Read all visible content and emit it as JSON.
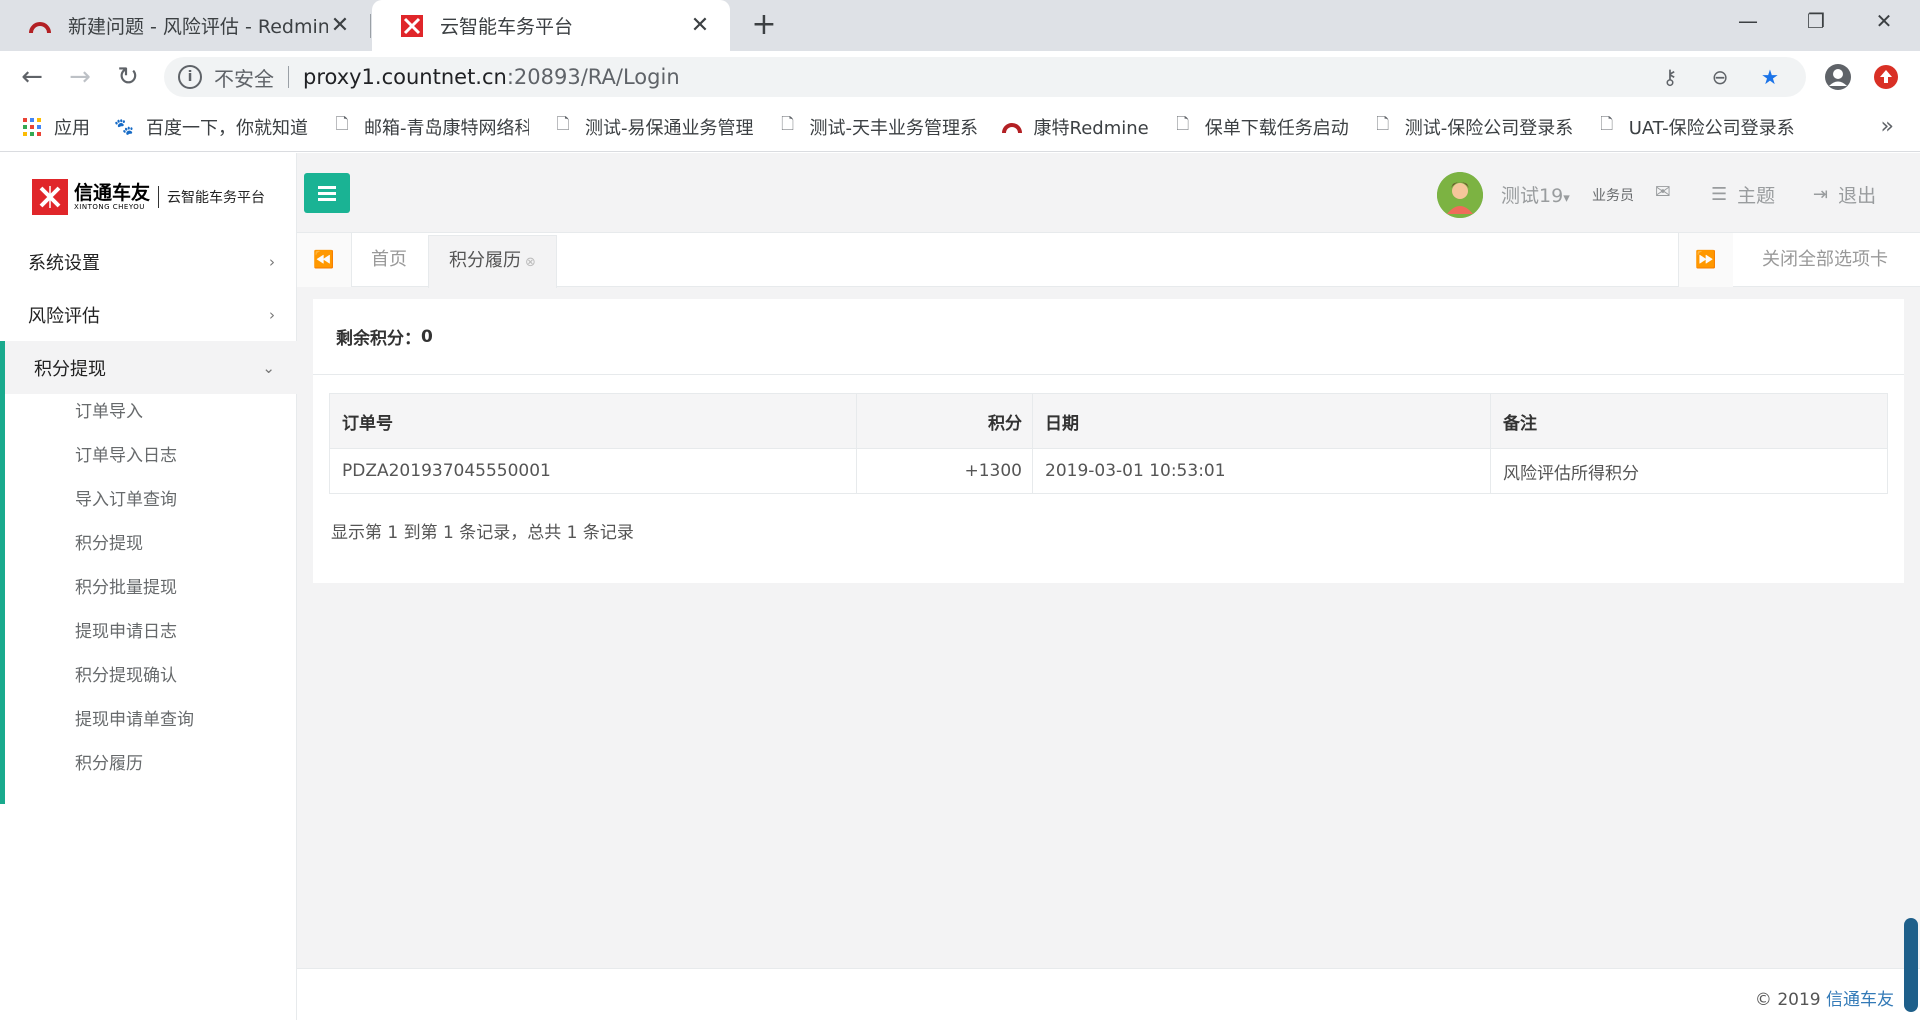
{
  "browser": {
    "tabs": [
      {
        "title": "新建问题 - 风险评估 - Redmine",
        "icon": "redmine-icon",
        "active": false
      },
      {
        "title": "云智能车务平台",
        "icon": "xintong-logo-icon",
        "active": true
      }
    ],
    "new_tab_icon": "+",
    "window_controls": {
      "minimize": "—",
      "restore": "❐",
      "close": "✕"
    },
    "address": {
      "security_label": "不安全",
      "host": "proxy1.countnet.cn",
      "rest": ":20893/RA/Login"
    },
    "bookmarks": [
      {
        "label": "应用",
        "icon": "apps-grid-icon"
      },
      {
        "label": "百度一下，你就知道",
        "icon": "baidu-paw-icon"
      },
      {
        "label": "邮箱-青岛康特网络科",
        "icon": "page-icon"
      },
      {
        "label": "测试-易保通业务管理",
        "icon": "page-icon"
      },
      {
        "label": "测试-天丰业务管理系",
        "icon": "page-icon"
      },
      {
        "label": "康特Redmine",
        "icon": "redmine-icon"
      },
      {
        "label": "保单下载任务启动",
        "icon": "page-icon"
      },
      {
        "label": "测试-保险公司登录系",
        "icon": "page-icon"
      },
      {
        "label": "UAT-保险公司登录系",
        "icon": "page-icon"
      }
    ],
    "bookmarks_more": "»"
  },
  "app": {
    "logo": {
      "cn": "信通车友",
      "en": "XINTONG CHEYOU",
      "sub": "云智能车务平台"
    },
    "menu": [
      {
        "label": "系统设置",
        "chevron": "›"
      },
      {
        "label": "风险评估",
        "chevron": "›"
      },
      {
        "label": "积分提现",
        "chevron": "⌄"
      }
    ],
    "submenu": [
      "订单导入",
      "订单导入日志",
      "导入订单查询",
      "积分提现",
      "积分批量提现",
      "提现申请日志",
      "积分提现确认",
      "提现申请单查询",
      "积分履历"
    ],
    "user": {
      "name": "测试19",
      "caret": "▾",
      "role": "业务员"
    },
    "topbar": {
      "theme": "主题",
      "logout": "退出"
    },
    "page_tabs": {
      "home": "首页",
      "active": "积分履历",
      "close_all": "关闭全部选项卡"
    },
    "panel": {
      "balance_label": "剩余积分：",
      "balance_value": "0",
      "columns": [
        "订单号",
        "积分",
        "日期",
        "备注"
      ],
      "rows": [
        {
          "order_no": "PDZA201937045550001",
          "points": "+1300",
          "date": "2019-03-01 10:53:01",
          "note": "风险评估所得积分"
        }
      ],
      "page_info": "显示第 1 到第 1 条记录，总共 1 条记录"
    },
    "footer": {
      "copyright": "© 2019 ",
      "link": "信通车友"
    },
    "colors": {
      "accent": "#1ab394",
      "brand_red": "#e0262a",
      "link": "#337ab7"
    }
  }
}
